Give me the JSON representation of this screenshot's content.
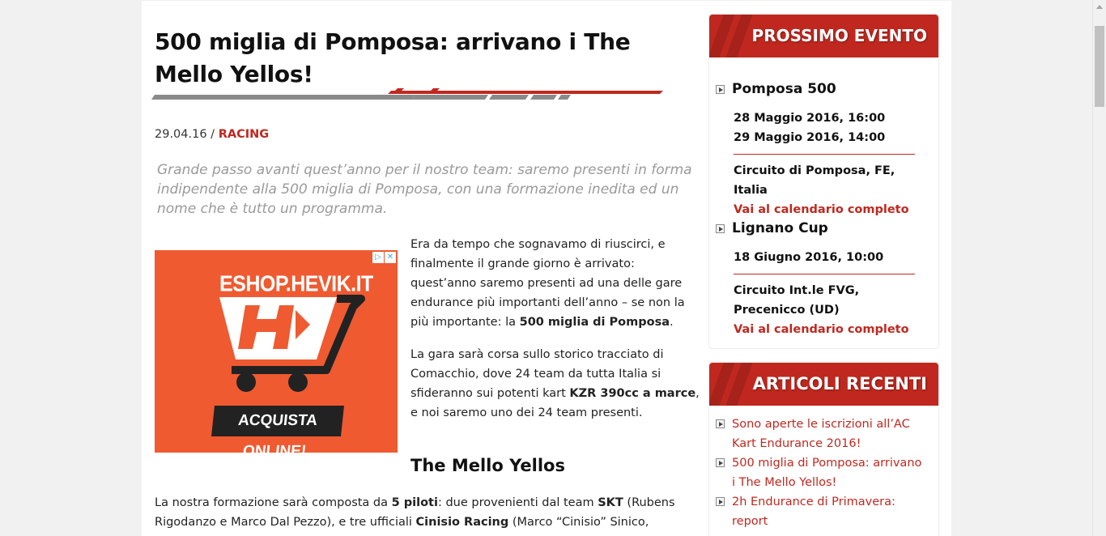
{
  "article": {
    "title": "500 miglia di Pomposa: arrivano i The Mello Yellos!",
    "date": "29.04.16",
    "separator": " / ",
    "category": "RACING",
    "lead": "Grande passo avanti quest’anno per il nostro team: saremo presenti in forma indipendente alla 500 miglia di Pomposa, con una formazione inedita ed un nome che è tutto un programma.",
    "p1_a": "Era da tempo che sognavamo di riuscirci, e finalmente il grande giorno è arrivato: quest’anno saremo presenti ad una delle gare endurance più importanti dell’anno – se non la più importante: la ",
    "p1_b": "500 miglia di Pomposa",
    "p1_c": ".",
    "p2_a": "La gara sarà corsa sullo storico tracciato di Comacchio, dove 24 team da tutta Italia si sfideranno sui potenti kart ",
    "p2_b": "KZR 390cc a marce",
    "p2_c": ", e noi saremo uno dei 24 team presenti.",
    "subheading": "The Mello Yellos",
    "p3_a": "La nostra formazione sarà composta da ",
    "p3_b": "5 piloti",
    "p3_c": ": due provenienti dal team ",
    "p3_d": "SKT",
    "p3_e": " (Rubens Rigodanzo e Marco Dal Pezzo), e tre ufficiali ",
    "p3_f": "Cinisio Racing",
    "p3_g": " (Marco “Cinisio” Sinico, Simone"
  },
  "ad": {
    "shop_text": "ESHOP.HEVIK.IT",
    "cta": "ACQUISTA ONLINE!",
    "logo_letter": "H",
    "badge_info": "▷",
    "badge_close": "✕",
    "bg_color": "#ef5a31"
  },
  "sidebar": {
    "next_event_title": "PROSSIMO EVENTO",
    "events": [
      {
        "name": "Pomposa 500",
        "date1": "28 Maggio 2016, 16:00",
        "date2": "29 Maggio 2016, 14:00",
        "place": "Circuito di Pomposa, FE, Italia",
        "link": "Vai al calendario completo"
      },
      {
        "name": "Lignano Cup",
        "date1": "18 Giugno 2016, 10:00",
        "place": "Circuito Int.le FVG, Precenicco (UD)",
        "link": "Vai al calendario completo"
      }
    ],
    "recent_title": "ARTICOLI RECENTI",
    "recent": [
      "Sono aperte le iscrizioni all’AC Kart Endurance 2016!",
      "500 miglia di Pomposa: arrivano i The Mello Yellos!",
      "2h Endurance di Primavera: report"
    ]
  },
  "colors": {
    "accent": "#c0281f",
    "lead_gray": "#9a9a9a"
  }
}
